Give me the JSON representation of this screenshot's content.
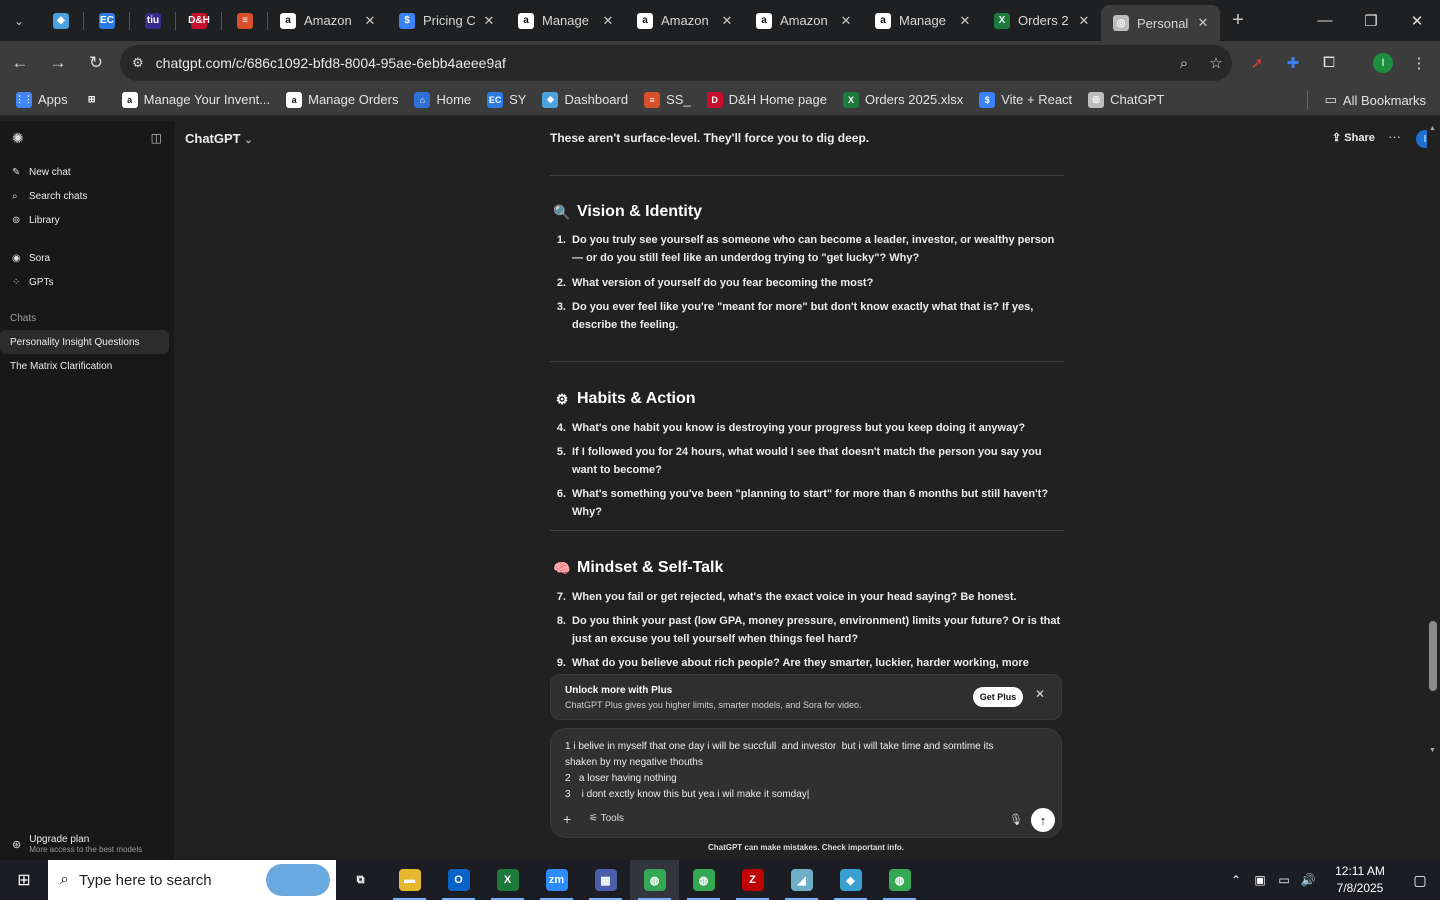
{
  "browser": {
    "pinned_tabs": [
      {
        "icon": "chevron-down-icon",
        "label": "⌄"
      },
      {
        "icon": "diamond-icon",
        "label": "◆",
        "color": "#4aa3df"
      },
      {
        "icon": "ec-icon",
        "label": "EC",
        "color": "#2c7be5"
      },
      {
        "icon": "tiu-icon",
        "label": "tiu",
        "color": "#3a2c8f"
      },
      {
        "icon": "dh-icon",
        "label": "D&H",
        "color": "#c8102e"
      },
      {
        "icon": "stack-icon",
        "label": "≡",
        "color": "#d94f2b"
      }
    ],
    "tabs": [
      {
        "title": "Amazon",
        "icon": "amazon-icon",
        "fav": "a",
        "color": "#ffffff"
      },
      {
        "title": "Pricing C",
        "icon": "dollar-icon",
        "fav": "$",
        "color": "#3b82f6"
      },
      {
        "title": "Manage",
        "icon": "amazon-icon",
        "fav": "a",
        "color": "#ffffff"
      },
      {
        "title": "Amazon",
        "icon": "amazon-icon",
        "fav": "a",
        "color": "#ffffff"
      },
      {
        "title": "Amazon",
        "icon": "amazon-icon",
        "fav": "a",
        "color": "#ffffff"
      },
      {
        "title": "Manage",
        "icon": "amazon-icon",
        "fav": "a",
        "color": "#ffffff"
      },
      {
        "title": "Orders 2",
        "icon": "excel-icon",
        "fav": "X",
        "color": "#1d7a3c"
      },
      {
        "title": "Personal",
        "icon": "chatgpt-icon",
        "fav": "◎",
        "color": "#bdbdbd",
        "active": true
      }
    ],
    "close_glyph": "✕",
    "newtab_glyph": "+",
    "window_controls": [
      "—",
      "❐",
      "✕"
    ],
    "url": "chatgpt.com/c/686c1092-bfd8-8004-95ae-6ebb4aeee9af",
    "bookmarks": [
      {
        "label": "Apps",
        "icon": "apps-grid-icon",
        "fav": "⋮⋮",
        "color": "#4285f4"
      },
      {
        "label": "",
        "icon": "tab-groups-icon",
        "fav": "⊞",
        "color": "#3c3c3c"
      },
      {
        "label": "Manage Your Invent...",
        "icon": "amazon-icon",
        "fav": "a",
        "color": "#ffffff"
      },
      {
        "label": "Manage Orders",
        "icon": "amazon-icon",
        "fav": "a",
        "color": "#ffffff"
      },
      {
        "label": "Home",
        "icon": "home-icon",
        "fav": "⌂",
        "color": "#2f6fd8"
      },
      {
        "label": "SY",
        "icon": "ec-icon",
        "fav": "EC",
        "color": "#2c7be5"
      },
      {
        "label": "Dashboard",
        "icon": "diamond-icon",
        "fav": "◆",
        "color": "#4aa3df"
      },
      {
        "label": "SS_",
        "icon": "stack-icon",
        "fav": "≡",
        "color": "#d94f2b"
      },
      {
        "label": "D&H Home page",
        "icon": "dh-icon",
        "fav": "D",
        "color": "#c8102e"
      },
      {
        "label": "Orders 2025.xlsx",
        "icon": "excel-icon",
        "fav": "X",
        "color": "#1d7a3c"
      },
      {
        "label": "Vite + React",
        "icon": "dollar-icon",
        "fav": "$",
        "color": "#3b82f6"
      },
      {
        "label": "ChatGPT",
        "icon": "chatgpt-icon",
        "fav": "◎",
        "color": "#bdbdbd"
      }
    ],
    "all_bookmarks": "All Bookmarks"
  },
  "sidebar": {
    "nav": [
      {
        "label": "New chat",
        "icon": "pencil-icon",
        "glyph": "✎"
      },
      {
        "label": "Search chats",
        "icon": "search-icon",
        "glyph": "⌕"
      },
      {
        "label": "Library",
        "icon": "library-icon",
        "glyph": "⊚"
      }
    ],
    "nav2": [
      {
        "label": "Sora",
        "icon": "sora-icon",
        "glyph": "◉"
      },
      {
        "label": "GPTs",
        "icon": "gpts-icon",
        "glyph": "⁘"
      }
    ],
    "section": "Chats",
    "chats": [
      {
        "label": "Personality Insight Questions",
        "active": true
      },
      {
        "label": "The Matrix Clarification",
        "active": false
      }
    ],
    "upgrade": {
      "title": "Upgrade plan",
      "subtitle": "More access to the best models"
    }
  },
  "header": {
    "model": "ChatGPT",
    "share": "Share",
    "avatar": "I"
  },
  "conversation": {
    "intro": "These aren't surface-level. They'll force you to dig deep.",
    "sections": [
      {
        "title": "Vision & Identity",
        "icon": "magnifier-icon",
        "glyph": "🔍",
        "questions": [
          {
            "num": "1.",
            "text": "Do you truly see yourself as someone who can become a leader, investor, or wealthy person — or do you still feel like an underdog trying to \"get lucky\"? Why?"
          },
          {
            "num": "2.",
            "text": "What version of yourself do you fear becoming the most?"
          },
          {
            "num": "3.",
            "text": "Do you ever feel like you're \"meant for more\" but don't know exactly what that is? If yes, describe the feeling."
          }
        ]
      },
      {
        "title": "Habits & Action",
        "icon": "gear-icon",
        "glyph": "⚙",
        "questions": [
          {
            "num": "4.",
            "text": "What's one habit you know is destroying your progress but you keep doing it anyway?"
          },
          {
            "num": "5.",
            "text": "If I followed you for 24 hours, what would I see that doesn't match the person you say you want to become?"
          },
          {
            "num": "6.",
            "text": "What's something you've been \"planning to start\" for more than 6 months but still haven't? Why?"
          }
        ]
      },
      {
        "title": "Mindset & Self-Talk",
        "icon": "brain-icon",
        "glyph": "🧠",
        "questions": [
          {
            "num": "7.",
            "text": "When you fail or get rejected, what's the exact voice in your head saying? Be honest."
          },
          {
            "num": "8.",
            "text": "Do you think your past (low GPA, money pressure, environment) limits your future? Or is that just an excuse you tell yourself when things feel hard?"
          },
          {
            "num": "9.",
            "text": "What do you believe about rich people? Are they smarter, luckier, harder working, more corrupt — or"
          }
        ]
      }
    ]
  },
  "banner": {
    "title": "Unlock more with Plus",
    "subtitle": "ChatGPT Plus gives you higher limits, smarter models, and Sora for video.",
    "button": "Get Plus",
    "close": "✕"
  },
  "composer": {
    "lines": [
      "1 i belive in myself that one day i will be succfull  and investor  but i will take time and somtime its",
      "shaken by my negative thouths",
      "2   a loser having nothing",
      "3    i dont exctly know this but yea i wil make it somday|"
    ],
    "tools": "Tools",
    "plus": "+",
    "send": "↑"
  },
  "disclaimer": "ChatGPT can make mistakes. Check important info.",
  "taskbar": {
    "search_placeholder": "Type here to search",
    "apps": [
      {
        "icon": "task-view-icon",
        "glyph": "⧉",
        "color": "#1b1d22"
      },
      {
        "icon": "file-explorer-icon",
        "glyph": "▬",
        "color": "#e8b730"
      },
      {
        "icon": "outlook-icon",
        "glyph": "O",
        "color": "#0a64c8"
      },
      {
        "icon": "excel-icon",
        "glyph": "X",
        "color": "#1d7a3c"
      },
      {
        "icon": "zoom-icon",
        "glyph": "zm",
        "color": "#2d8cff"
      },
      {
        "icon": "calculator-icon",
        "glyph": "▦",
        "color": "#4a5eaa"
      },
      {
        "icon": "chrome-icon",
        "glyph": "◍",
        "color": "#34a853",
        "active": true
      },
      {
        "icon": "chrome-icon",
        "glyph": "◍",
        "color": "#34a853"
      },
      {
        "icon": "filezilla-icon",
        "glyph": "Z",
        "color": "#bf0000"
      },
      {
        "icon": "app-icon",
        "glyph": "◢",
        "color": "#6fb0c8"
      },
      {
        "icon": "diamond-app-icon",
        "glyph": "◆",
        "color": "#3aa0d0"
      },
      {
        "icon": "chrome-profile-icon",
        "glyph": "◍",
        "color": "#34a853"
      }
    ],
    "time": "12:11 AM",
    "date": "7/8/2025"
  }
}
